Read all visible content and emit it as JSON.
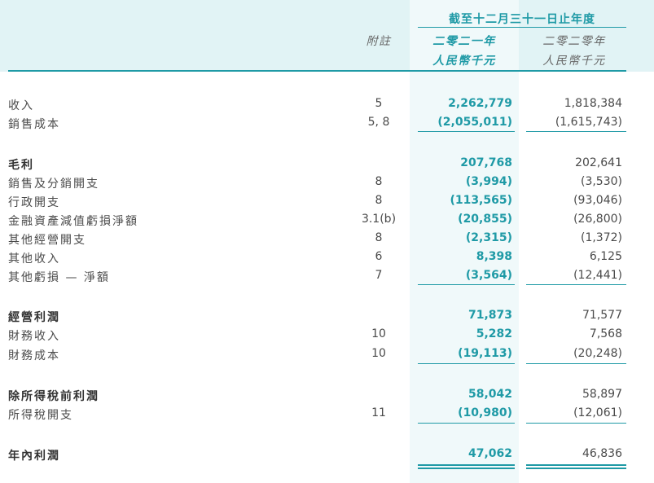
{
  "header": {
    "group_heading": "截至十二月三十一日止年度",
    "note_label": "附註",
    "current_year": "二零二一年",
    "current_unit": "人民幣千元",
    "prior_year": "二零二零年",
    "prior_unit": "人民幣千元"
  },
  "rows": [
    {
      "label": "收入",
      "note": "5",
      "current": "2,262,779",
      "prior": "1,818,384"
    },
    {
      "label": "銷售成本",
      "note": "5, 8",
      "current": "(2,055,011)",
      "prior": "(1,615,743)"
    },
    {
      "label": "毛利",
      "note": "",
      "current": "207,768",
      "prior": "202,641"
    },
    {
      "label": "銷售及分銷開支",
      "note": "8",
      "current": "(3,994)",
      "prior": "(3,530)"
    },
    {
      "label": "行政開支",
      "note": "8",
      "current": "(113,565)",
      "prior": "(93,046)"
    },
    {
      "label": "金融資產減值虧損淨額",
      "note": "3.1(b)",
      "current": "(20,855)",
      "prior": "(26,800)"
    },
    {
      "label": "其他經營開支",
      "note": "8",
      "current": "(2,315)",
      "prior": "(1,372)"
    },
    {
      "label": "其他收入",
      "note": "6",
      "current": "8,398",
      "prior": "6,125"
    },
    {
      "label": "其他虧損 — 淨額",
      "note": "7",
      "current": "(3,564)",
      "prior": "(12,441)"
    },
    {
      "label": "經營利潤",
      "note": "",
      "current": "71,873",
      "prior": "71,577"
    },
    {
      "label": "財務收入",
      "note": "10",
      "current": "5,282",
      "prior": "7,568"
    },
    {
      "label": "財務成本",
      "note": "10",
      "current": "(19,113)",
      "prior": "(20,248)"
    },
    {
      "label": "除所得稅前利潤",
      "note": "",
      "current": "58,042",
      "prior": "58,897"
    },
    {
      "label": "所得稅開支",
      "note": "11",
      "current": "(10,980)",
      "prior": "(12,061)"
    },
    {
      "label": "年內利潤",
      "note": "",
      "current": "47,062",
      "prior": "46,836"
    }
  ]
}
